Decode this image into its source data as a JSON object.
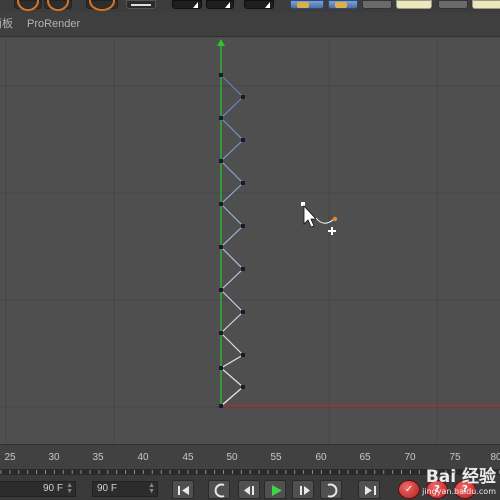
{
  "menu": {
    "partial_item": "面板",
    "prorender": "ProRender"
  },
  "timeline": {
    "ticks": [
      "25",
      "30",
      "35",
      "40",
      "45",
      "50",
      "55",
      "60",
      "65",
      "70",
      "75",
      "80"
    ],
    "marker_label": "50"
  },
  "transport": {
    "start_frame": "90 F",
    "end_frame": "90 F",
    "rec_button_labels": [
      "✓",
      "?",
      "?"
    ]
  },
  "viewport": {
    "axis_colors": {
      "y": "#28c828",
      "x": "#c02828",
      "spline": "#5b7bc0",
      "cursor_orange": "#e28a2a"
    }
  },
  "watermark": {
    "text": "Bai 经验",
    "url": "jingyan.baidu.com"
  },
  "icons": [
    "lasso-icon",
    "move-icon",
    "scale-icon",
    "rotate-icon",
    "render-icon",
    "cursor-arrow-icon",
    "add-point-icon"
  ]
}
